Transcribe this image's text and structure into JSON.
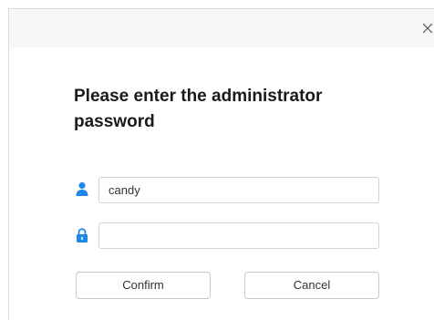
{
  "dialog": {
    "heading": "Please enter the administrator password",
    "close_icon": "close-icon",
    "username": {
      "icon": "user-icon",
      "value": "candy",
      "placeholder": ""
    },
    "password": {
      "icon": "lock-icon",
      "value": "",
      "placeholder": ""
    },
    "confirm_label": "Confirm",
    "cancel_label": "Cancel"
  },
  "colors": {
    "accent": "#1e88e5",
    "titlebar": "#f7f7f7",
    "border": "#d4d4d4"
  }
}
